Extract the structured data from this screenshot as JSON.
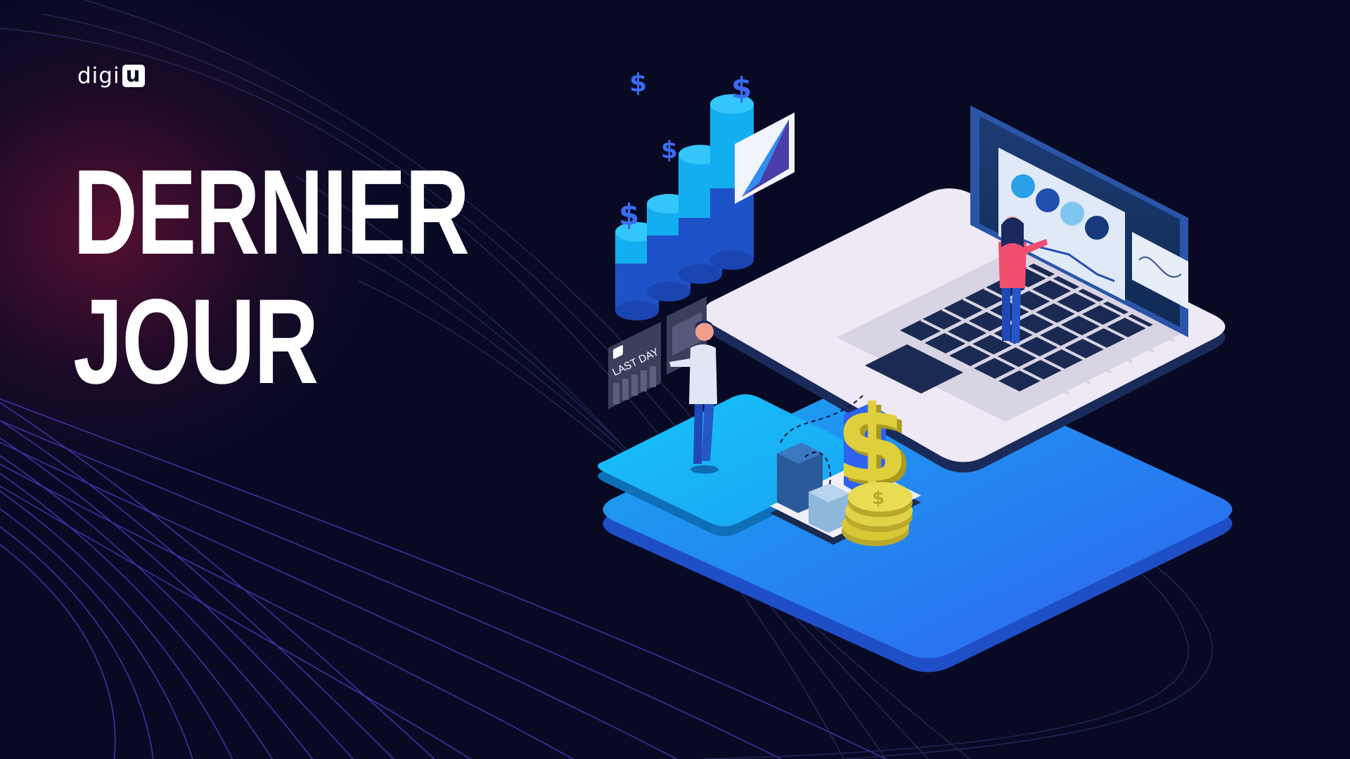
{
  "brand": {
    "name_prefix": "digi",
    "name_box": "u"
  },
  "headline": {
    "line1": "DERNIER",
    "line2": "JOUR"
  },
  "illustration": {
    "panel_text": "LAST DAY",
    "panel_logo": "U",
    "coin_symbol": "$",
    "floating_symbol": "$"
  },
  "colors": {
    "background": "#080a24",
    "accent_glow": "#8c143c",
    "platform_cyan": "#19b8f5",
    "platform_blue": "#2f6cf0",
    "laptop_body": "#f1ecf7",
    "gold": "#d9c637",
    "line_purple": "#5a3cc8"
  }
}
